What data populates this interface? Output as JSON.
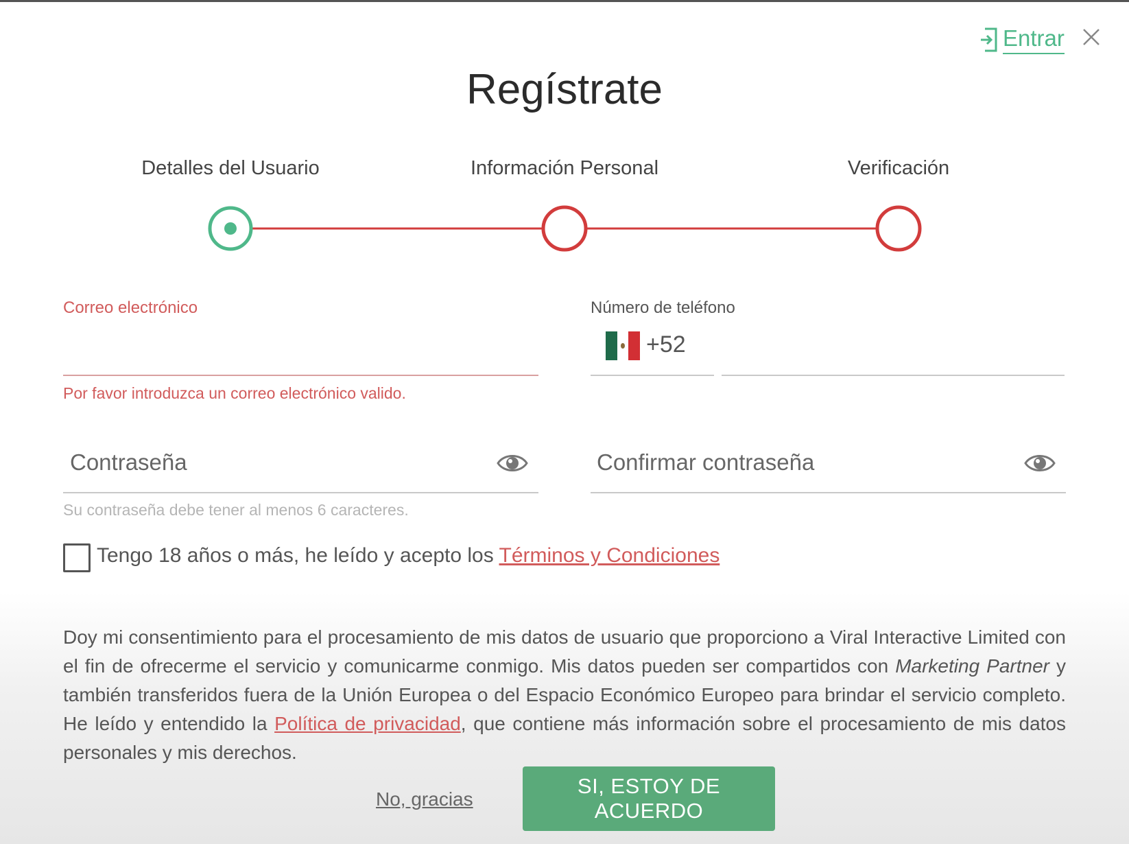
{
  "header": {
    "title": "Regístrate",
    "login_label": "Entrar",
    "login_icon": "login-icon",
    "close_icon": "close-icon"
  },
  "stepper": {
    "steps": [
      {
        "label": "Detalles del Usuario",
        "state": "active"
      },
      {
        "label": "Información Personal",
        "state": "pending"
      },
      {
        "label": "Verificación",
        "state": "pending"
      }
    ],
    "colors": {
      "active": "#4fb88a",
      "pending": "#d23c3c"
    }
  },
  "form": {
    "email": {
      "label": "Correo electrónico",
      "value": "",
      "error": "Por favor introduzca un correo electrónico valido."
    },
    "phone": {
      "label": "Número de teléfono",
      "country_flag": "mexico-flag",
      "dial_code": "+52",
      "value": ""
    },
    "password": {
      "placeholder": "Contraseña",
      "hint": "Su contraseña debe tener al menos 6 caracteres.",
      "toggle_icon": "eye-icon"
    },
    "confirm_password": {
      "placeholder": "Confirmar contraseña",
      "toggle_icon": "eye-icon"
    },
    "terms": {
      "checked": false,
      "text": "Tengo 18 años o más, he leído y acepto los ",
      "link": "Términos y Condiciones"
    }
  },
  "consent": {
    "part1": "Doy mi consentimiento para el procesamiento de mis datos de usuario que proporciono a Viral Interactive Limited con el fin de ofrecerme el servicio y comunicarme conmigo. Mis datos pueden ser compartidos con ",
    "partner": "Marketing Partner",
    "part2": " y también transferidos fuera de la Unión Europea o del Espacio Económico Europeo para brindar el servicio completo. He leído y entendido la ",
    "privacy_link": "Política de privacidad",
    "part3": ", que contiene más información sobre el procesamiento de mis datos personales y mis derechos."
  },
  "actions": {
    "decline_label": "No, gracias",
    "accept_label": "SI, ESTOY DE ACUERDO"
  },
  "colors": {
    "accent_green": "#4fb88a",
    "button_green": "#5aaa7a",
    "error_red": "#d15b5b"
  }
}
